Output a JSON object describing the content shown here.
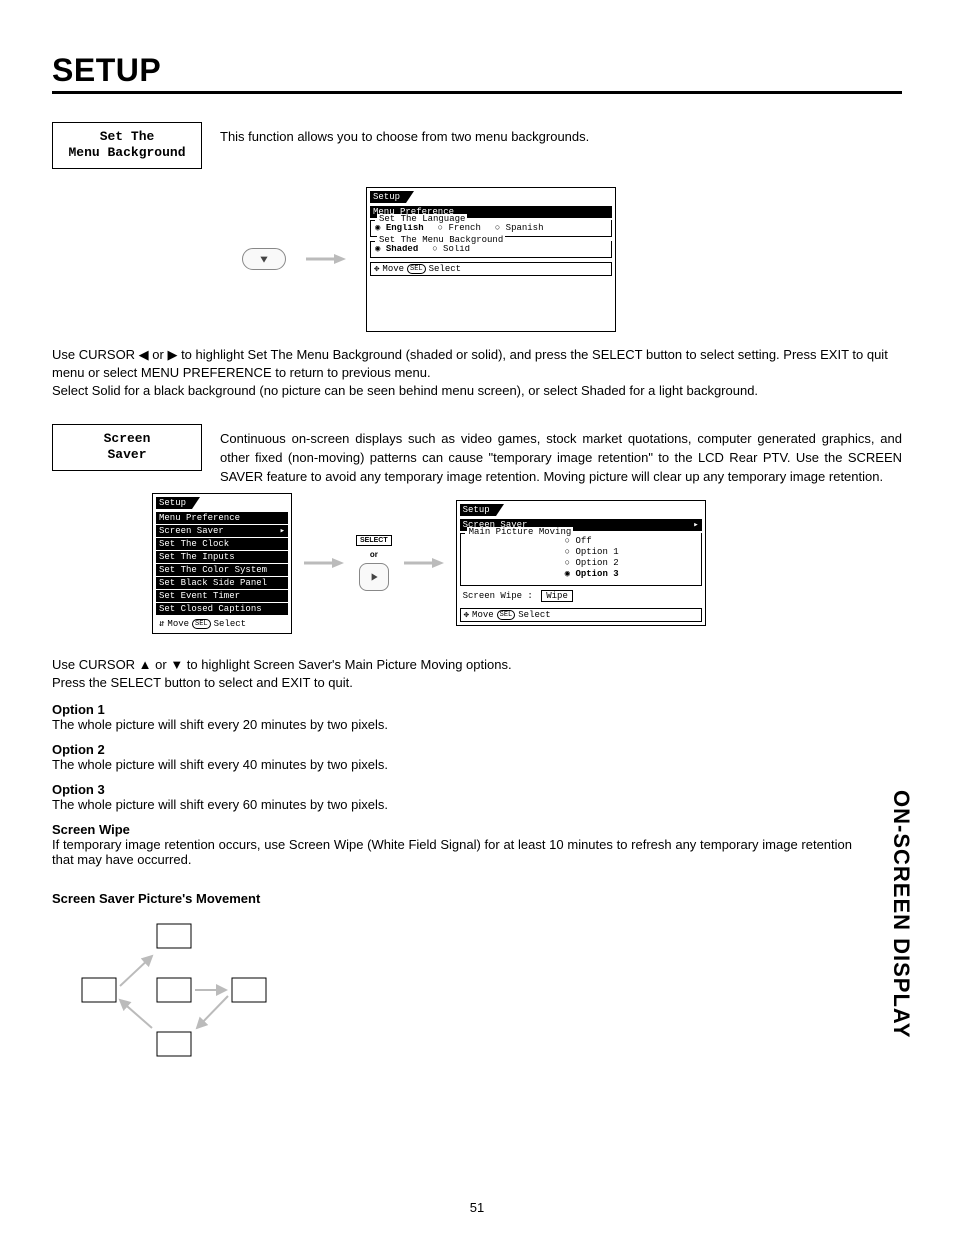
{
  "page_title": "SETUP",
  "page_number": "51",
  "side_label": "ON-SCREEN DISPLAY",
  "sec1": {
    "box_line1": "Set The",
    "box_line2": "Menu Background",
    "desc": "This function allows you to choose from two menu backgrounds.",
    "instructions_p1": "Use CURSOR ◀ or ▶ to highlight Set The Menu Background (shaded or solid), and press the SELECT button to select setting. Press EXIT to quit menu or select MENU PREFERENCE to return to previous menu.",
    "instructions_p2": "Select Solid for a black background (no picture can be seen behind menu screen), or select Shaded for a light background."
  },
  "osd1": {
    "title": "Setup",
    "row1": "Menu Preference",
    "legend1": "Set The Language",
    "lang": [
      "English",
      "French",
      "Spanish"
    ],
    "legend2": "Set The Menu Background",
    "bg": [
      "Shaded",
      "Solid"
    ],
    "hint_move": "Move",
    "hint_select": "Select"
  },
  "sec2": {
    "box_line1": "Screen",
    "box_line2": "Saver",
    "desc": "Continuous on-screen displays such as video games, stock market quotations, computer generated graphics, and other fixed (non-moving) patterns can cause \"temporary image retention\" to the LCD Rear PTV.  Use the SCREEN SAVER feature to avoid any temporary image retention.  Moving picture will clear up any temporary image retention.",
    "instructions_p1": "Use CURSOR ▲ or ▼ to highlight Screen Saver's Main Picture Moving options.",
    "instructions_p2": "Press the SELECT button to select and EXIT to quit."
  },
  "osd2a": {
    "title": "Setup",
    "items": [
      "Menu Preference",
      "Screen Saver",
      "Set The Clock",
      "Set The Inputs",
      "Set The Color System",
      "Set Black Side Panel",
      "Set Event Timer",
      "Set Closed Captions"
    ],
    "highlighted_index": 1,
    "hint_move": "Move",
    "hint_select": "Select"
  },
  "mid_labels": {
    "select_btn": "SELECT",
    "or": "or"
  },
  "osd2b": {
    "title": "Setup",
    "row1": "Screen Saver",
    "legend": "Main Picture Moving",
    "options": [
      "Off",
      "Option 1",
      "Option 2",
      "Option 3"
    ],
    "selected_index": 3,
    "wipe_label": "Screen Wipe :",
    "wipe_btn": "Wipe",
    "hint_move": "Move",
    "hint_select": "Select"
  },
  "options_text": {
    "o1_h": "Option 1",
    "o1_t": "The whole picture will shift every 20 minutes by two pixels.",
    "o2_h": "Option 2",
    "o2_t": "The whole picture will shift every 40 minutes by two pixels.",
    "o3_h": "Option 3",
    "o3_t": "The whole picture will shift every 60 minutes by two pixels.",
    "sw_h": "Screen Wipe",
    "sw_t": "If temporary image retention occurs, use Screen Wipe (White Field Signal) for at least 10 minutes to refresh any temporary image retention that may have occurred.",
    "mv_h": "Screen Saver Picture's Movement"
  }
}
